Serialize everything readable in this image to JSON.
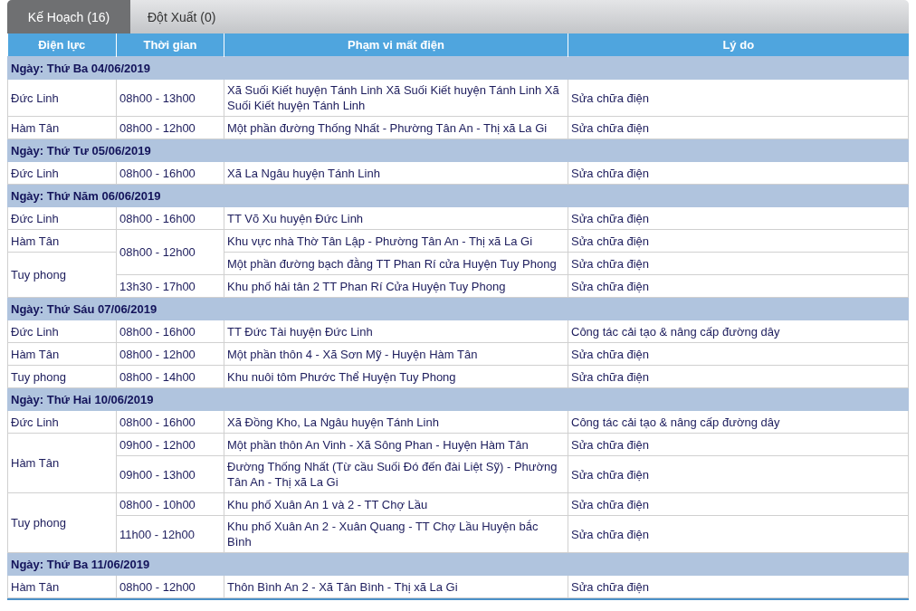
{
  "tabs": [
    {
      "label": "Kế Hoạch (16)",
      "selected": true
    },
    {
      "label": "Đột Xuất (0)",
      "selected": false
    }
  ],
  "table": {
    "columns": [
      "Điện lực",
      "Thời gian",
      "Phạm vi mất điện",
      "Lý do"
    ],
    "groups": [
      {
        "date": "Ngày: Thứ Ba 04/06/2019",
        "rows": [
          {
            "unit": "Đức Linh",
            "time": "08h00 - 13h00",
            "area": "Xã Suối Kiết huyện Tánh Linh Xã Suối Kiết huyện Tánh Linh Xã Suối Kiết huyện Tánh Linh",
            "reason": "Sửa chữa điện"
          },
          {
            "unit": "Hàm Tân",
            "time": "08h00 - 12h00",
            "area": "Một phần đường Thống Nhất - Phường Tân An - Thị xã La Gi",
            "reason": "Sửa chữa điện"
          }
        ]
      },
      {
        "date": "Ngày: Thứ Tư 05/06/2019",
        "rows": [
          {
            "unit": "Đức Linh",
            "time": "08h00 - 16h00",
            "area": "Xã La Ngâu huyện Tánh Linh",
            "reason": "Sửa chữa điện"
          }
        ]
      },
      {
        "date": "Ngày: Thứ Năm 06/06/2019",
        "rows": [
          {
            "unit": "Đức Linh",
            "time": "08h00 - 16h00",
            "area": "TT Võ Xu huyện Đức Linh",
            "reason": "Sửa chữa điện"
          },
          {
            "unit": "Hàm Tân",
            "time": "08h00 - 12h00",
            "area": "Khu vực nhà Thờ Tân Lập - Phường Tân An - Thị xã La Gi",
            "reason": "Sửa chữa điện"
          },
          {
            "unit": "Tuy phong",
            "area": "Một phần đường bạch đằng TT Phan Rí cửa Huyện Tuy Phong",
            "reason": "Sửa chữa điện"
          },
          {
            "time": "13h30 - 17h00",
            "area": "Khu phố hải tân 2 TT Phan Rí Cửa Huyện Tuy Phong",
            "reason": "Sửa chữa điện"
          }
        ]
      },
      {
        "date": "Ngày: Thứ Sáu 07/06/2019",
        "rows": [
          {
            "unit": "Đức Linh",
            "time": "08h00 - 16h00",
            "area": "TT Đức Tài huyện Đức Linh",
            "reason": "Công tác cải tạo & nâng cấp đường dây"
          },
          {
            "unit": "Hàm Tân",
            "time": "08h00 - 12h00",
            "area": "Một phần thôn 4 - Xã Sơn Mỹ - Huyện Hàm Tân",
            "reason": "Sửa chữa điện"
          },
          {
            "unit": "Tuy phong",
            "time": "08h00 - 14h00",
            "area": "Khu nuôi tôm Phước Thể Huyện Tuy Phong",
            "reason": "Sửa chữa điện"
          }
        ]
      },
      {
        "date": "Ngày: Thứ Hai 10/06/2019",
        "rows": [
          {
            "unit": "Đức Linh",
            "time": "08h00 - 16h00",
            "area": "Xã Đồng Kho, La Ngâu huyện Tánh Linh",
            "reason": "Công tác cải tạo & nâng cấp đường dây"
          },
          {
            "unit": "Hàm Tân",
            "time": "09h00 - 12h00",
            "area": "Một phần thôn An Vinh - Xã Sông Phan - Huyện Hàm Tân",
            "reason": "Sửa chữa điện"
          },
          {
            "time": "09h00 - 13h00",
            "area": "Đường Thống Nhất (Từ cầu Suối Đó đến đài Liệt Sỹ) - Phường Tân An - Thị xã La Gi",
            "reason": "Sửa chữa điện"
          },
          {
            "unit": "Tuy phong",
            "time": "08h00 - 10h00",
            "area": "Khu phố Xuân An 1 và 2 - TT Chợ Lầu",
            "reason": "Sửa chữa điện"
          },
          {
            "time": "11h00 - 12h00",
            "area": "Khu phố Xuân An 2 - Xuân Quang - TT Chợ Lầu Huyện bắc Bình",
            "reason": "Sửa chữa điện"
          }
        ]
      },
      {
        "date": "Ngày: Thứ Ba 11/06/2019",
        "rows": [
          {
            "unit": "Hàm Tân",
            "time": "08h00 - 12h00",
            "area": "Thôn Bình An 2 - Xã Tân Bình - Thị xã La Gi",
            "reason": "Sửa chữa điện"
          }
        ]
      }
    ]
  }
}
